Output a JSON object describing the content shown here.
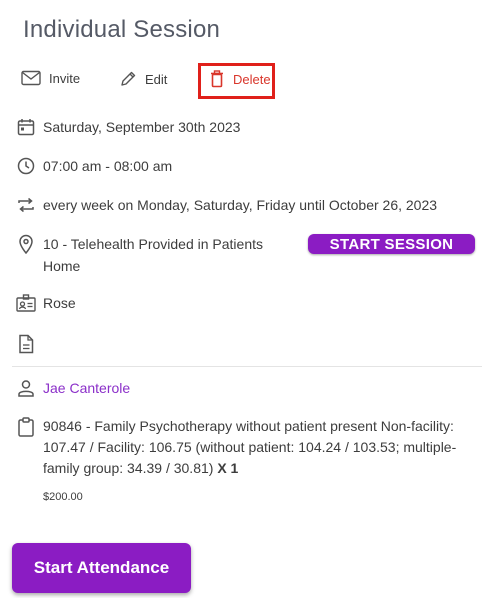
{
  "header": {
    "title": "Individual Session"
  },
  "actions": {
    "invite_label": "Invite",
    "edit_label": "Edit",
    "delete_label": "Delete"
  },
  "details": {
    "date": "Saturday, September 30th 2023",
    "time": "07:00 am - 08:00 am",
    "recurrence": "every week on Monday, Saturday, Friday until October 26, 2023",
    "location": "10 - Telehealth Provided in Patients Home",
    "start_session_label": "START SESSION",
    "client": "Rose",
    "note": ""
  },
  "patient": {
    "name": "Jae Canterole"
  },
  "procedure": {
    "description": "90846 - Family Psychotherapy without patient present Non-facility: 107.47 / Facility: 106.75 (without patient: 104.24 / 103.53; multiple-family group: 34.39 / 30.81)",
    "quantity": "X 1",
    "price": "$200.00"
  },
  "footer": {
    "start_attendance_label": "Start Attendance"
  },
  "colors": {
    "accent": "#8b1cc3",
    "delete": "#d9362b",
    "highlight_box": "#e0201a",
    "link": "#8b2fc9"
  }
}
